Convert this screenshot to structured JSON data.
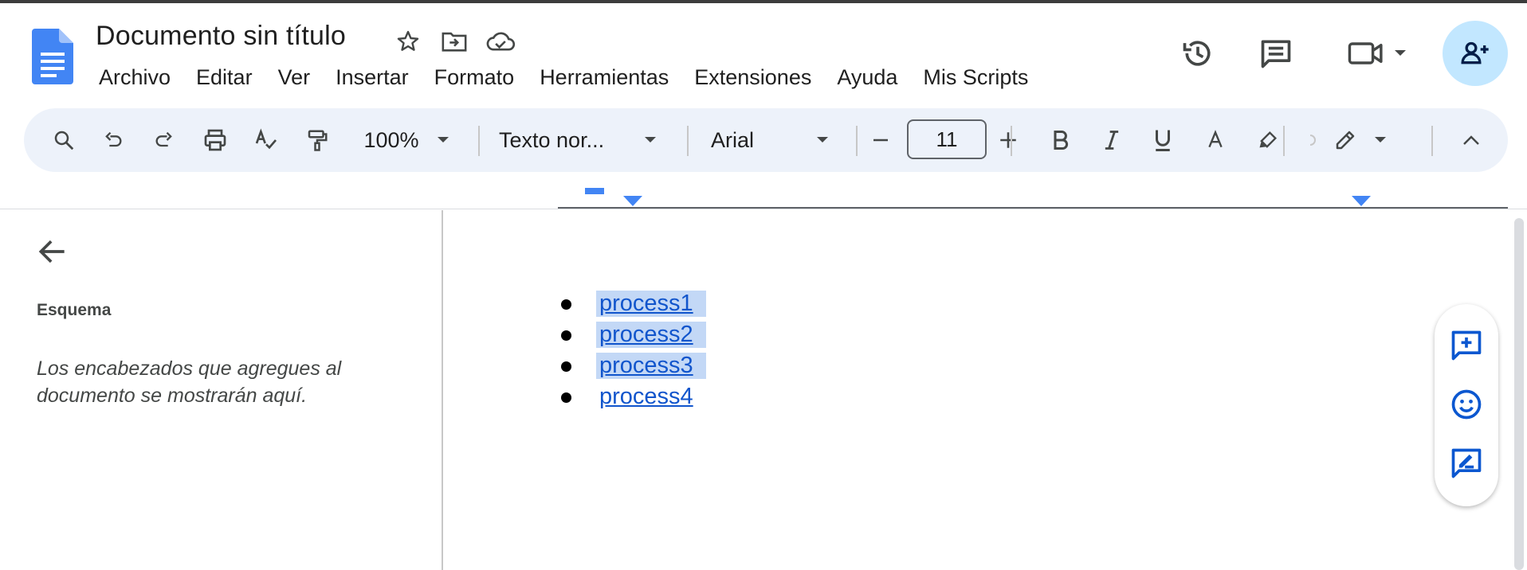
{
  "header": {
    "title": "Documento sin título",
    "menu": [
      "Archivo",
      "Editar",
      "Ver",
      "Insertar",
      "Formato",
      "Herramientas",
      "Extensiones",
      "Ayuda",
      "Mis Scripts"
    ],
    "icons": [
      "star-icon",
      "move-folder-icon",
      "cloud-saved-icon",
      "history-icon",
      "comments-icon",
      "meet-camera-icon",
      "share-add-person-icon"
    ]
  },
  "toolbar": {
    "zoom": "100%",
    "style": "Texto nor...",
    "font": "Arial",
    "font_size": "11"
  },
  "sidebar": {
    "title": "Esquema",
    "empty_text": "Los encabezados que agregues al documento se mostrarán aquí."
  },
  "document": {
    "items": [
      {
        "text": "process1",
        "selected": true
      },
      {
        "text": "process2",
        "selected": true
      },
      {
        "text": "process3",
        "selected": true
      },
      {
        "text": "process4",
        "selected": false
      }
    ]
  },
  "colors": {
    "accent": "#4285f4",
    "link": "#1155cc",
    "selection": "#c3d8f6",
    "toolbar_bg": "#edf2fa",
    "share_bg": "#c2e7ff"
  }
}
